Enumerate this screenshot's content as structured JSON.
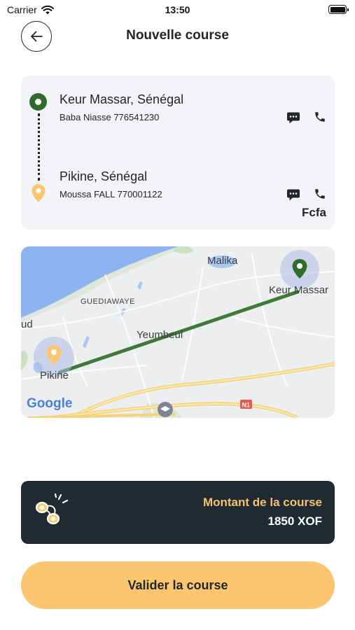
{
  "status_bar": {
    "carrier": "Carrier",
    "time": "13:50",
    "battery_level": 1.0
  },
  "header": {
    "title": "Nouvelle course",
    "back_icon": "arrow-left-icon"
  },
  "trip": {
    "origin": {
      "place": "Keur Massar, Sénégal",
      "contact": "Baba Niasse 776541230",
      "pin_color": "#2e6b2c"
    },
    "destination": {
      "place": "Pikine, Sénégal",
      "contact": "Moussa FALL 770001122",
      "pin_color": "#fbc66f"
    },
    "message_icon": "chat-bubble-icon",
    "call_icon": "phone-icon",
    "currency": "Fcfa"
  },
  "map": {
    "labels": {
      "malika": "Malika",
      "keur_massar": "Keur Massar",
      "guediawaye": "GUEDIAWAYE",
      "yeumbeul": "Yeumbeul",
      "pikine": "Pikine",
      "aud": "ud",
      "google": "Google",
      "road_badge": "N1"
    },
    "route_color": "#3d7a36"
  },
  "amount": {
    "label": "Montant de la course",
    "value": "1850 XOF",
    "icon": "coins-icon",
    "label_color": "#f3c26a"
  },
  "actions": {
    "validate_label": "Valider la course",
    "accent": "#fbc66f"
  }
}
